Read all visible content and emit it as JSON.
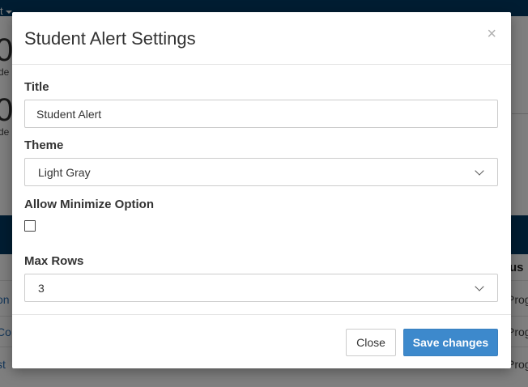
{
  "background": {
    "topbar_fragment": "t",
    "stat_values": [
      "0",
      "0"
    ],
    "stat_label_fragments": [
      "de",
      "de"
    ],
    "column_header_fragment": "tus",
    "link_fragments": [
      "on",
      "Co",
      "st"
    ],
    "cell_fragments": [
      "Prog",
      "Prog",
      "Prog"
    ]
  },
  "modal": {
    "title": "Student Alert Settings",
    "close_glyph": "×",
    "fields": {
      "title": {
        "label": "Title",
        "value": "Student Alert"
      },
      "theme": {
        "label": "Theme",
        "selected": "Light Gray"
      },
      "allow_minimize": {
        "label": "Allow Minimize Option",
        "checked": false
      },
      "max_rows": {
        "label": "Max Rows",
        "selected": "3"
      }
    },
    "footer": {
      "close_label": "Close",
      "save_label": "Save changes"
    }
  },
  "colors": {
    "topbar": "#003a64",
    "primary_button": "#3d89cc",
    "link": "#2a6fb5"
  },
  "icons": {
    "dialog_close": "close-icon",
    "select_arrow": "chevron-down-icon",
    "topbar_caret": "caret-down-icon"
  }
}
